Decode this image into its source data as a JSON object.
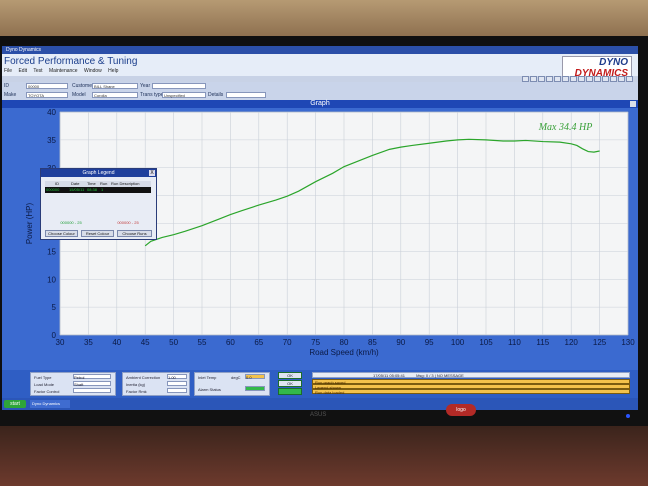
{
  "window": {
    "titlebar": "Dyno Dynamics",
    "app_title": "Forced Performance & Tuning",
    "menu": [
      "File",
      "Edit",
      "Test",
      "Maintenance",
      "Window",
      "Help"
    ]
  },
  "logo": {
    "line1": "DYNO",
    "line2": "DYNAMICS"
  },
  "fields": {
    "id_label": "ID",
    "id_value": "00000",
    "customer_label": "Customer",
    "customer_value": "BILL Shane",
    "year_label": "Year",
    "year_value": "",
    "make_label": "Make",
    "make_value": "TOYOTA",
    "model_label": "Model",
    "model_value": "Corolla",
    "trans_label": "Trans type",
    "trans_value": "Unspecified",
    "details_label": "Details",
    "details_value": ""
  },
  "graph_header": "Graph",
  "legend": {
    "title": "Graph Legend",
    "close": "X",
    "headers": [
      "ID",
      "Date",
      "Time",
      "Run",
      "Run Description"
    ],
    "row": [
      "000000",
      "15/05/11",
      "08:38",
      "1",
      ""
    ],
    "tab_left": "000000 - 25",
    "tab_right": "000000 - 25",
    "buttons": [
      "Choose Colour",
      "Reset Colour",
      "Choose Runs"
    ]
  },
  "chart_data": {
    "type": "line",
    "xlabel": "Road Speed (km/h)",
    "ylabel": "Power (HP)",
    "xlim": [
      30,
      130
    ],
    "ylim": [
      0,
      40
    ],
    "xticks": [
      30,
      35,
      40,
      45,
      50,
      55,
      60,
      65,
      70,
      75,
      80,
      85,
      90,
      95,
      100,
      105,
      110,
      115,
      120,
      125,
      130
    ],
    "yticks": [
      0,
      5,
      10,
      15,
      20,
      25,
      30,
      35,
      40
    ],
    "annotation": "Max 34.4 HP",
    "grid": true,
    "series": [
      {
        "color": "#2ba52b",
        "x": [
          45,
          46,
          48,
          50,
          52,
          55,
          58,
          60,
          62,
          65,
          68,
          70,
          72,
          75,
          78,
          80,
          82,
          85,
          88,
          90,
          92,
          95,
          98,
          100,
          102,
          105,
          108,
          110,
          112,
          115,
          118,
          120,
          121,
          122,
          123,
          124,
          125
        ],
        "y": [
          16.0,
          16.8,
          17.5,
          18.0,
          18.6,
          19.6,
          20.8,
          21.6,
          22.3,
          23.3,
          24.2,
          24.9,
          25.8,
          27.5,
          29.0,
          30.2,
          31.0,
          32.2,
          33.3,
          33.7,
          34.0,
          34.4,
          34.8,
          35.0,
          35.1,
          35.0,
          34.8,
          34.8,
          34.9,
          34.7,
          34.6,
          34.3,
          34.0,
          33.4,
          32.9,
          32.8,
          33.0
        ]
      }
    ]
  },
  "status": {
    "fuel_type_label": "Fuel Type",
    "fuel_type_value": "Petrol",
    "load_mode_label": "Load Mode",
    "load_mode_value": "Shaft",
    "factor_label": "Factor Control",
    "factor_value": "",
    "ambient_label": "Ambient Correction",
    "ambient_value": "1.00",
    "inertia_label": "Inertia (kg)",
    "inertia_value": "",
    "factor_rmk_label": "Factor Rmk",
    "factor_rmk_value": "",
    "inlet_temp_label": "Inlet Temp",
    "inlet_temp_unit": "degC",
    "inlet_temp_value": "0.0",
    "alarm_label": "Alarm Status",
    "mid_btn1": "OK",
    "mid_btn2": "OK",
    "clock": "17/05/11 05:05:41",
    "message_title": "Msg: 0 / 3 | NO MESSAGE",
    "messages": [
      "Run graph saved",
      "Legend shown",
      "Run data loaded"
    ]
  },
  "taskbar": {
    "start": "start",
    "task": "Dyno Dynamics"
  },
  "monitor": {
    "brand": "ASUS",
    "sticker": "logo"
  }
}
